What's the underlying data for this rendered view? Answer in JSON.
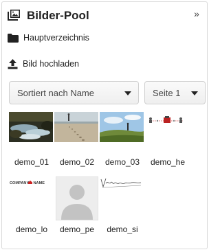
{
  "header": {
    "title": "Bilder-Pool",
    "collapse_glyph": "»",
    "icon": "image-stack-icon"
  },
  "folder": {
    "label": "Hauptverzeichnis",
    "icon": "folder-icon"
  },
  "upload": {
    "label": "Bild hochladen",
    "icon": "upload-icon"
  },
  "sort_select": {
    "value": "Sortiert nach Name"
  },
  "page_select": {
    "value": "Seite 1"
  },
  "images": [
    {
      "caption": "demo_01"
    },
    {
      "caption": "demo_02"
    },
    {
      "caption": "demo_03"
    },
    {
      "caption": "demo_he"
    },
    {
      "caption": "demo_lo",
      "logo_text_left": "COMPANY",
      "logo_text_right": "NAME"
    },
    {
      "caption": "demo_pe"
    },
    {
      "caption": "demo_si"
    }
  ]
}
